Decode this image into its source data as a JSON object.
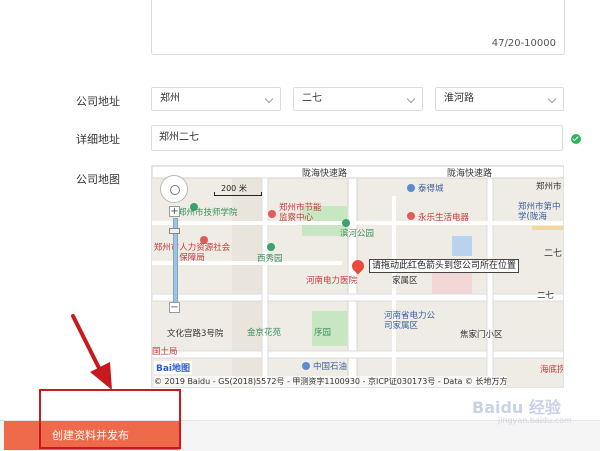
{
  "description": {
    "counter": "47/20-10000"
  },
  "address": {
    "label": "公司地址",
    "province": "郑州",
    "district": "二七",
    "street": "淮河路"
  },
  "detail": {
    "label": "详细地址",
    "value": "郑州二七"
  },
  "map": {
    "label": "公司地图",
    "scale": "200 米",
    "marker_text": "请拖动此红色箭头到您公司所在位置",
    "roads": [
      "陇海快速路",
      "陇海快速路",
      "二七"
    ],
    "pois": [
      "郑州市技师学院",
      "郑州市节能监察中心",
      "滨河公园",
      "泰得城",
      "永乐生活电器",
      "郑州市第中学(陇海",
      "郑州市人力资源社会保障局",
      "西秀园",
      "河南电力医院",
      "家属区",
      "河南省电力公司家属区",
      "文化宫路3号院",
      "金京花苑",
      "序园",
      "焦家门小区",
      "中国石油",
      "国土局",
      "海底捞",
      "郑州市",
      "二七"
    ],
    "logo": "Bai地图",
    "copyright": "© 2019 Baidu - GS(2018)5572号 - 甲测资字1100930 - 京ICP证030173号 - Data © 长地万方",
    "colors": {
      "road": "#ffffff",
      "water": "#b9d3ee",
      "park": "#c7e6c2",
      "marker": "#e84a3c"
    }
  },
  "footer": {
    "publish_label": "创建资料并发布"
  },
  "watermark": {
    "text": "Baidu 经验",
    "sub": "jingyan.baidu.com"
  },
  "colors": {
    "accent": "#ef6a4a",
    "highlight": "#c8191d",
    "valid": "#2bb45a"
  }
}
